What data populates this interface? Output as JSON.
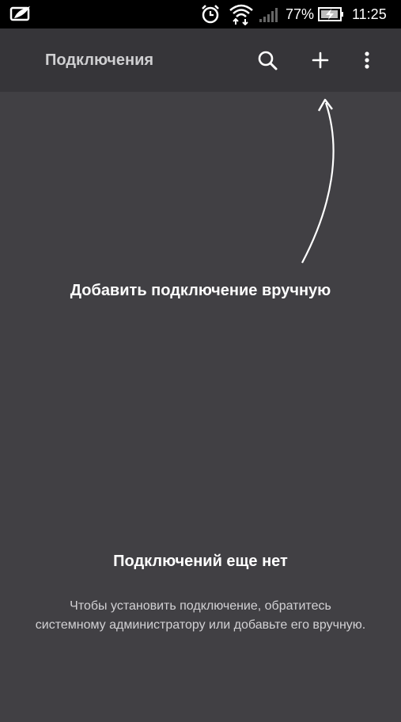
{
  "status_bar": {
    "battery_percent": "77%",
    "time": "11:25",
    "icons": [
      "app-notification-icon",
      "alarm-clock-icon",
      "wifi-icon",
      "cellular-signal-icon",
      "battery-charging-icon"
    ]
  },
  "app_bar": {
    "title": "Подключения",
    "actions": [
      "search-icon",
      "add-icon",
      "more-vert-icon"
    ]
  },
  "hint": {
    "label": "Добавить подключение вручную"
  },
  "empty_state": {
    "title": "Подключений еще нет",
    "description": "Чтобы установить подключение, обратитесь системному администратору или добавьте его вручную."
  },
  "colors": {
    "background": "#414044",
    "app_bar": "#363539",
    "status_bar": "#000000",
    "text_primary": "#ffffff",
    "text_secondary": "#d2d1d4"
  }
}
